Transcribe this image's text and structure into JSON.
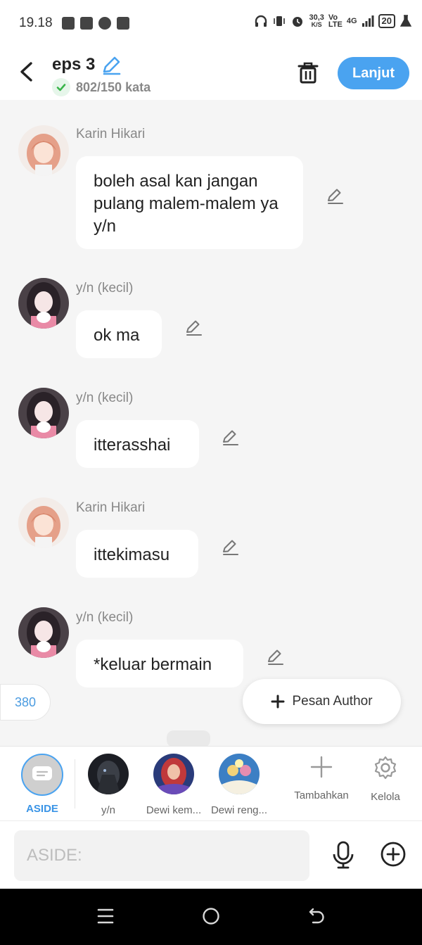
{
  "status_bar": {
    "time": "19.18",
    "net_speed_value": "30,3",
    "net_speed_unit": "K/S",
    "volte_top": "Vo",
    "volte_bottom": "LTE",
    "network": "4G",
    "battery": "20"
  },
  "header": {
    "title": "eps 3",
    "word_count": "802/150 kata",
    "next_label": "Lanjut"
  },
  "messages": [
    {
      "sender": "Karin Hikari",
      "text": "boleh asal kan jangan pulang malem-malem ya y/n",
      "avatar": "karin-avatar"
    },
    {
      "sender": "y/n (kecil)",
      "text": "ok ma",
      "avatar": "yn-kecil-avatar"
    },
    {
      "sender": "y/n (kecil)",
      "text": "itterasshai",
      "avatar": "yn-kecil-avatar"
    },
    {
      "sender": "Karin Hikari",
      "text": "ittekimasu",
      "avatar": "karin-avatar"
    },
    {
      "sender": "y/n (kecil)",
      "text": "*keluar bermain",
      "avatar": "yn-kecil-avatar"
    }
  ],
  "floating": {
    "count": "380",
    "author_message_label": "Pesan Author"
  },
  "characters": [
    {
      "label": "ASIDE",
      "icon": "chat-bubble-icon",
      "selected": true
    },
    {
      "label": "y/n",
      "icon": "dark-knight-avatar"
    },
    {
      "label": "Dewi kem...",
      "icon": "goddess-avatar"
    },
    {
      "label": "Dewi reng...",
      "icon": "angel-group-avatar"
    }
  ],
  "tools": {
    "add_label": "Tambahkan",
    "manage_label": "Kelola"
  },
  "composer": {
    "placeholder": "ASIDE:"
  },
  "colors": {
    "accent": "#4aa3f0",
    "background": "#f5f5f5",
    "bubble": "#ffffff",
    "check_green": "#39b54a"
  }
}
